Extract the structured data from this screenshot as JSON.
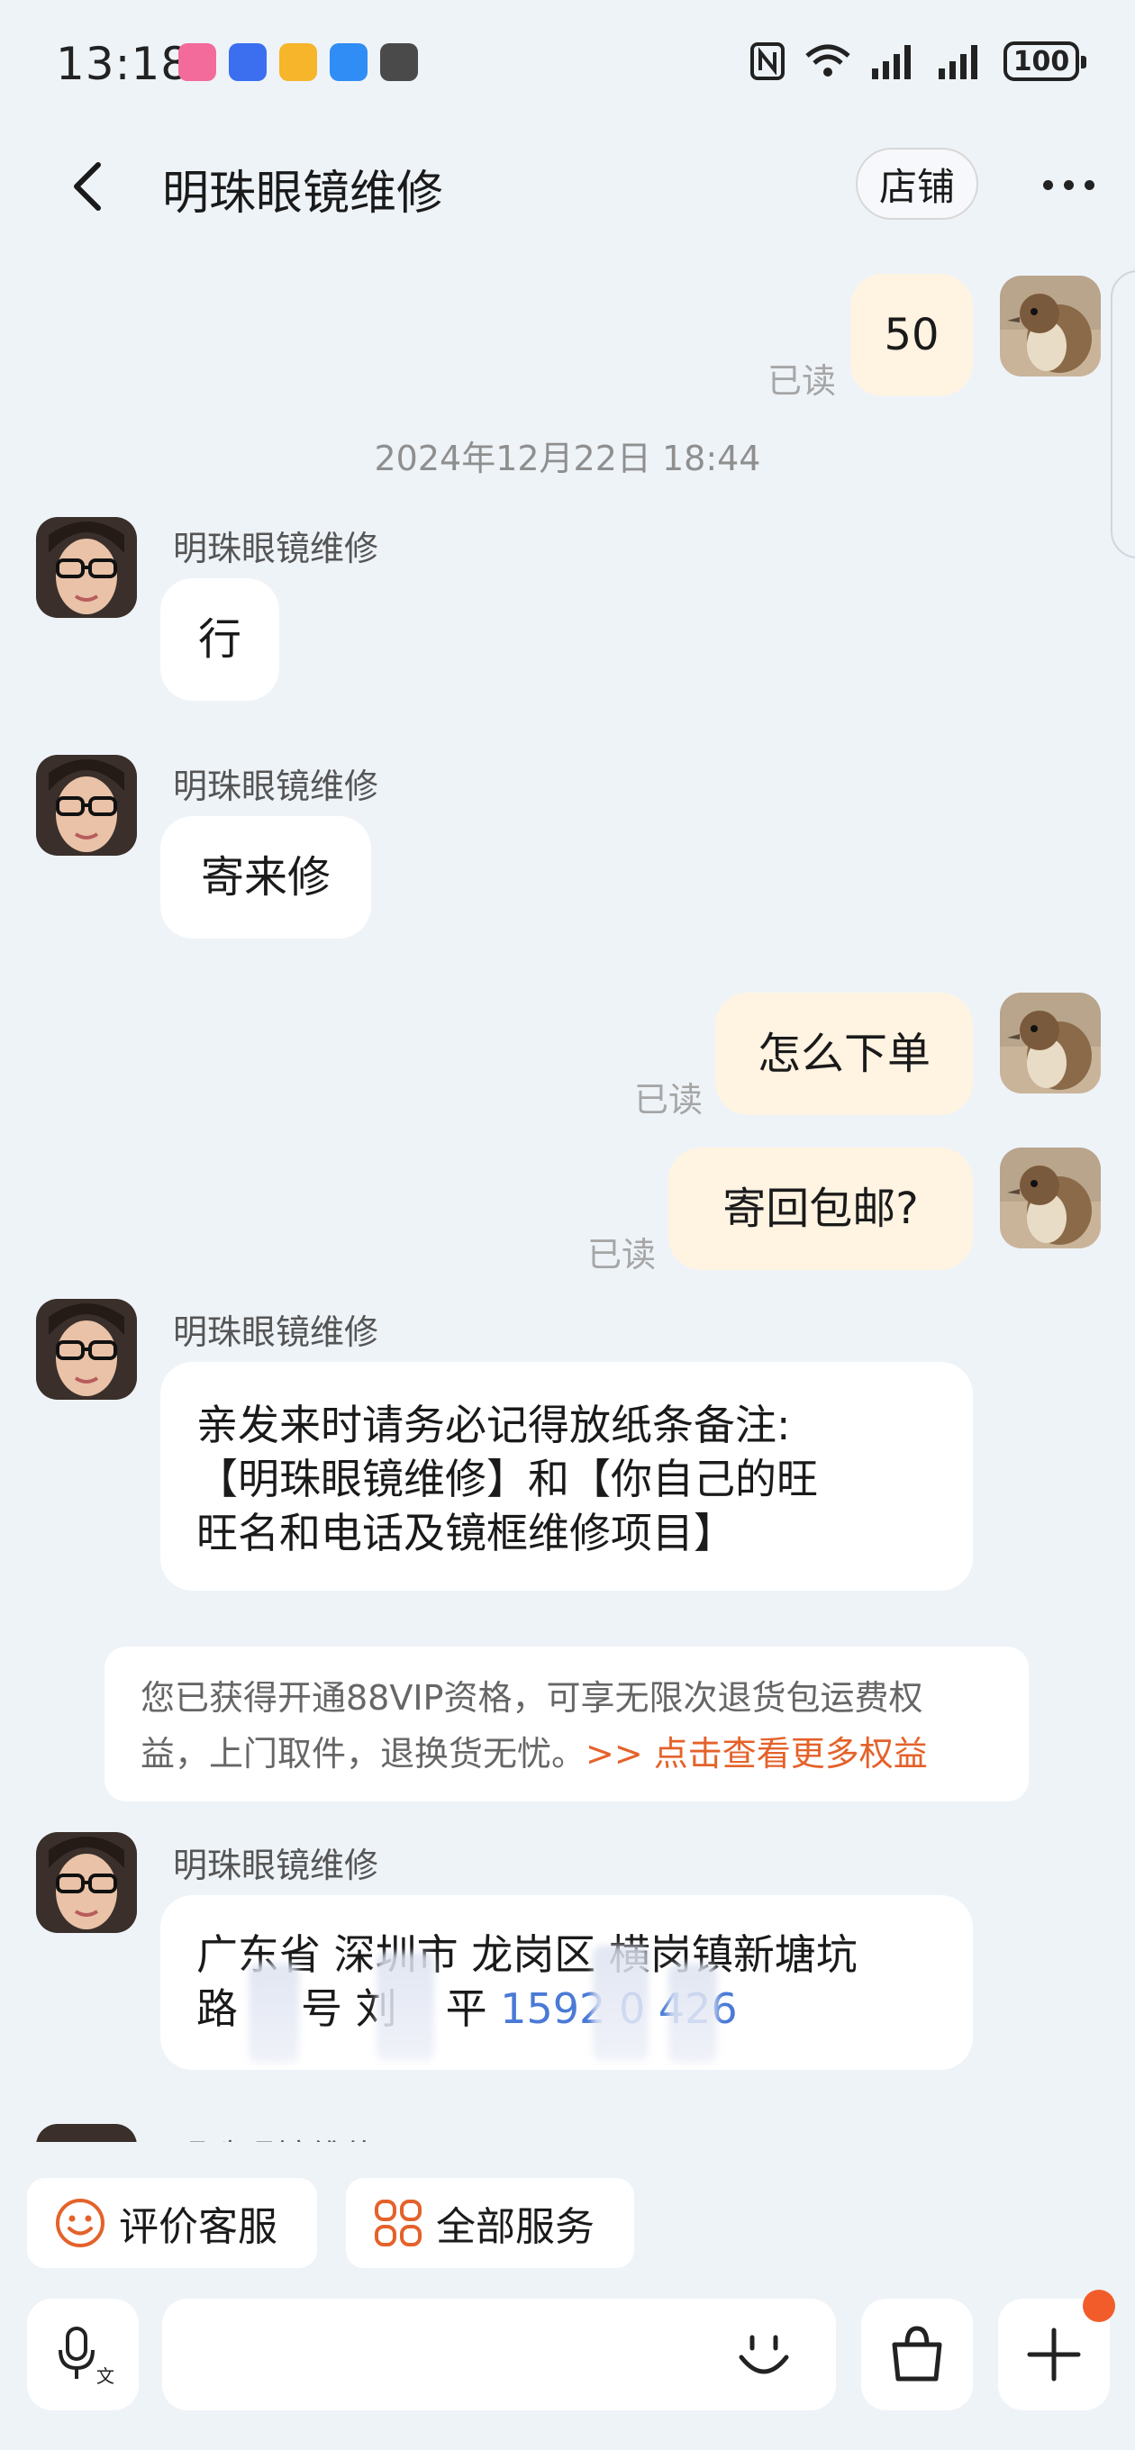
{
  "status_bar": {
    "time": "13:18",
    "battery": "100",
    "app_icons": [
      {
        "name": "bilibili-icon",
        "color": "#f26b9a"
      },
      {
        "name": "voice-recorder-icon",
        "color": "#3b6ff0"
      },
      {
        "name": "mail-icon",
        "color": "#f6b52a"
      },
      {
        "name": "messages-icon",
        "color": "#2f8df5"
      },
      {
        "name": "calligraphy-app-icon",
        "color": "#4a4a4a"
      }
    ]
  },
  "header": {
    "title": "明珠眼镜维修",
    "shop_label": "店铺"
  },
  "messages": {
    "m1": {
      "text": "50",
      "status": "已读"
    },
    "timestamp": "2024年12月22日 18:44",
    "m2": {
      "sender": "明珠眼镜维修",
      "text": "行"
    },
    "m3": {
      "sender": "明珠眼镜维修",
      "text": "寄来修"
    },
    "m4": {
      "text": "怎么下单",
      "status": "已读"
    },
    "m5": {
      "text": "寄回包邮?",
      "status": "已读"
    },
    "m6": {
      "sender": "明珠眼镜维修",
      "lines": [
        "亲发来时请务必记得放纸条备注:",
        "【明珠眼镜维修】和【你自己的旺",
        "旺名和电话及镜框维修项目】"
      ]
    },
    "notice": {
      "line1": "您已获得开通88VIP资格，可享无限次退货包运费权",
      "line2": "益，上门取件，退换货无忧。",
      "link": ">> 点击查看更多权益"
    },
    "m7": {
      "sender": "明珠眼镜维修",
      "line1": "广东省 深圳市 龙岗区 横岗镇新塘坑",
      "line2_prefix": "路",
      "line2_mid": "号 刘",
      "line2_end": "平",
      "phone": "1592 0 426"
    },
    "partial_sender": "明珠眼镜维修"
  },
  "quick_actions": {
    "rate": "评价客服",
    "all_services": "全部服务"
  },
  "input": {
    "placeholder": ""
  },
  "colors": {
    "background": "#eef3f8",
    "outgoing_bubble": "#fff3e2",
    "incoming_bubble": "#ffffff",
    "accent_orange": "#e4622a",
    "link_blue": "#4a7ad6"
  }
}
